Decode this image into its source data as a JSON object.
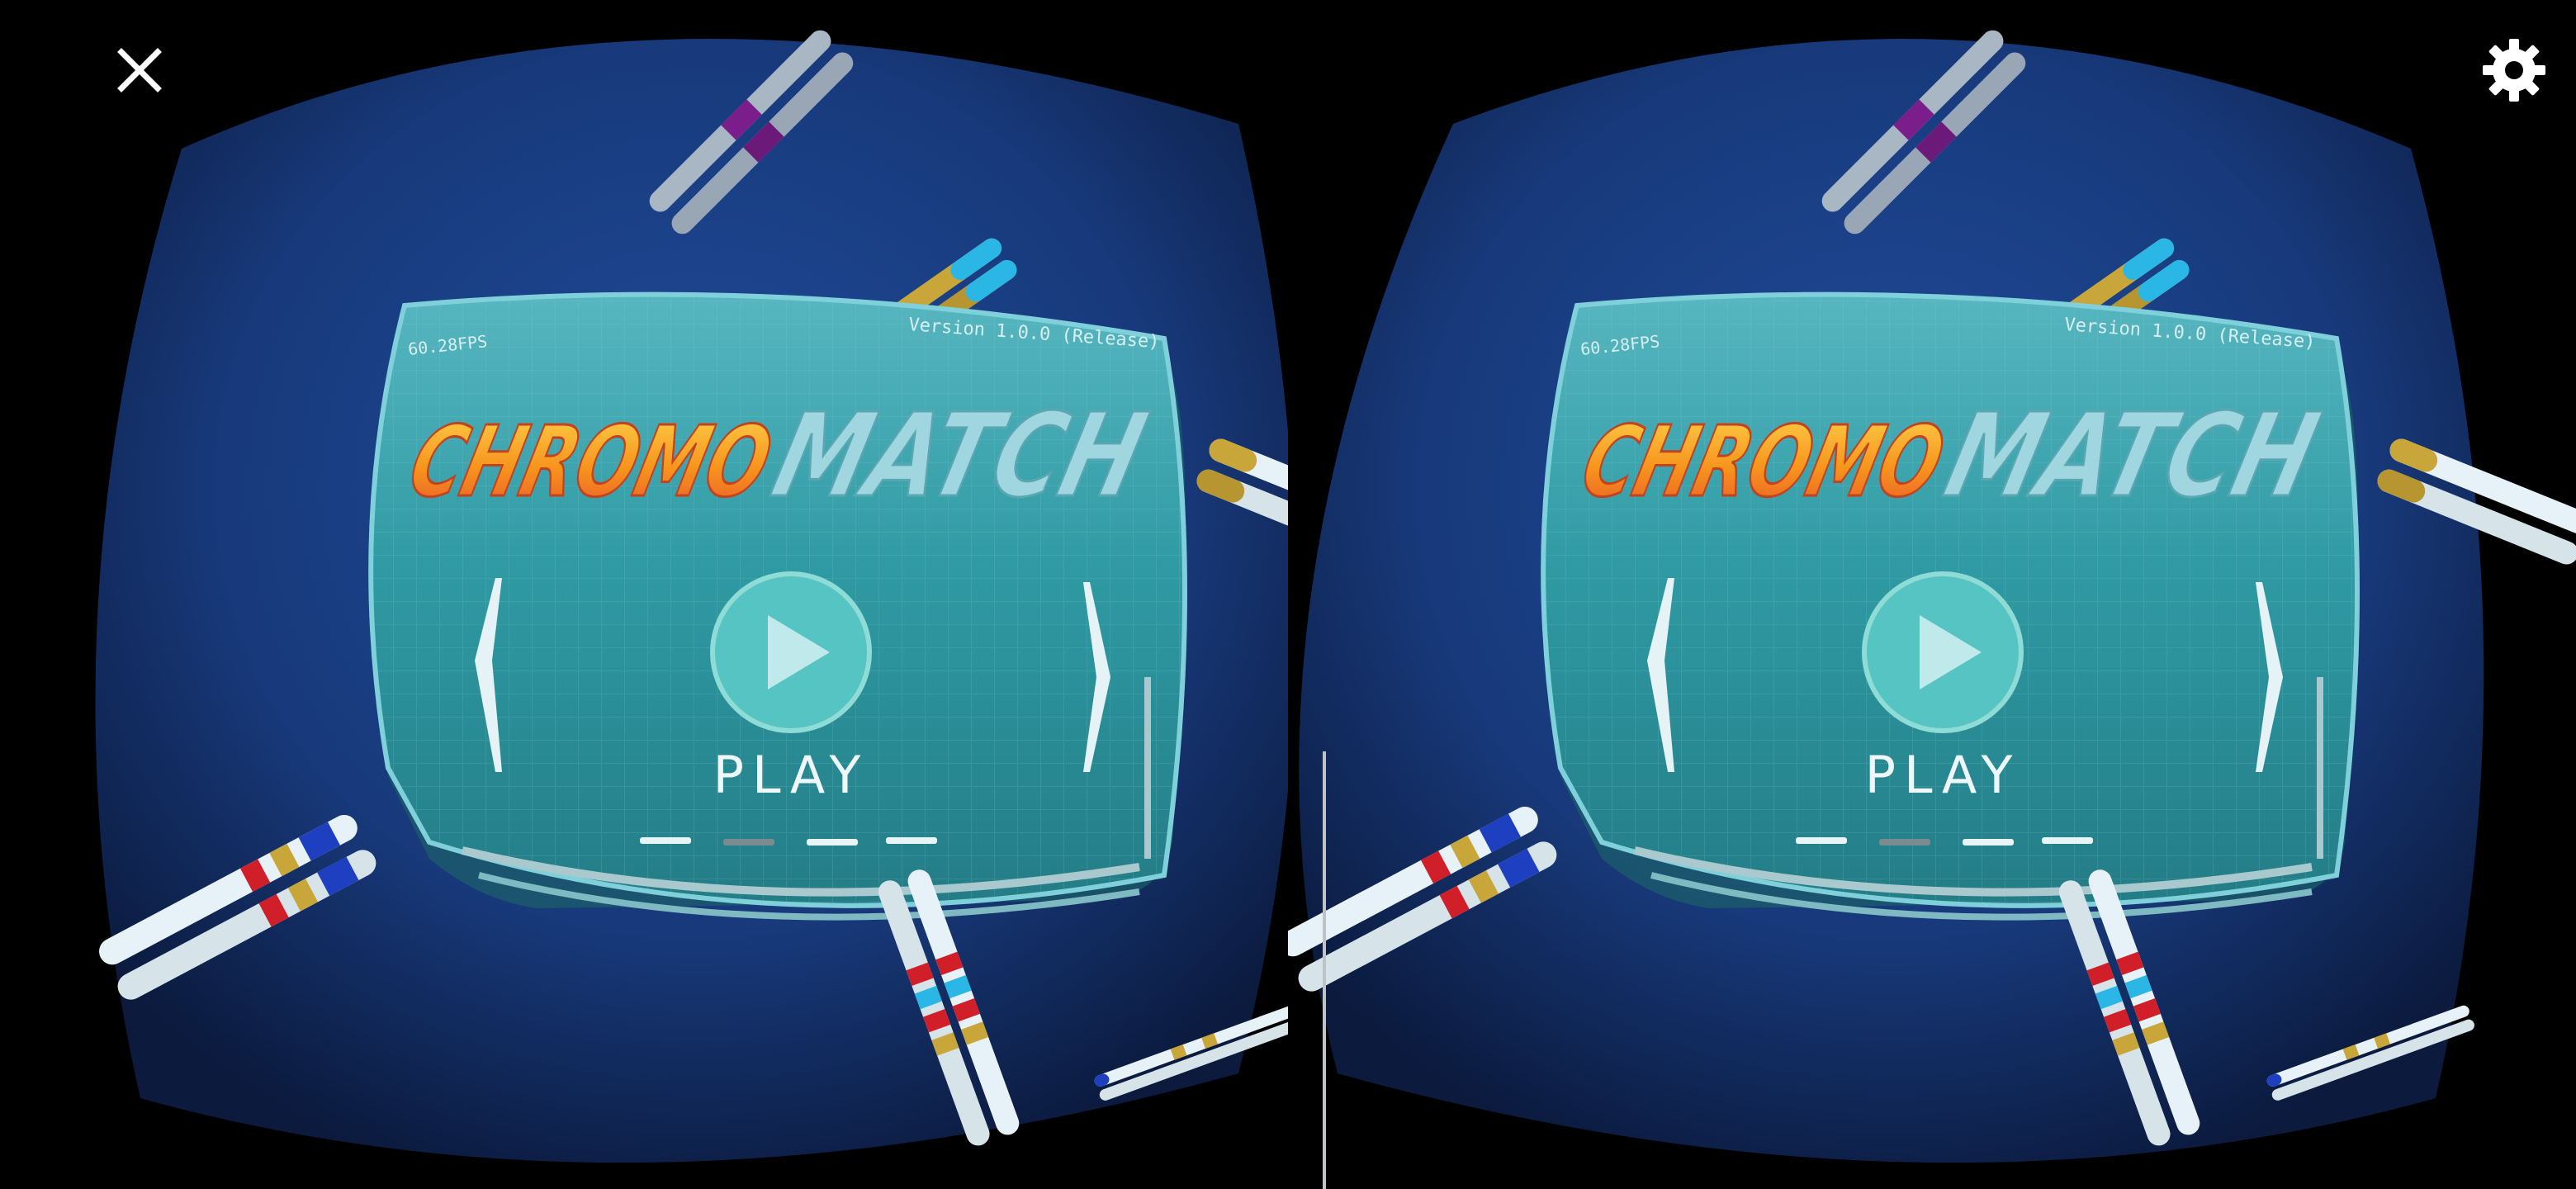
{
  "controls": {
    "close_icon": "close-icon",
    "settings_icon": "gear-icon"
  },
  "menu": {
    "fps": "60.28FPS",
    "version": "Version 1.0.0 (Release)",
    "title_part1": "CHROMO",
    "title_part2": "MATCH",
    "play_label": "PLAY",
    "page_indicator": {
      "count": 4,
      "active": 2
    }
  },
  "colors": {
    "background": "#000000",
    "vr_sky": "#1a3d86",
    "panel": "#2f9aa3",
    "title_orange": "#f7a21b",
    "title_cyan": "#8fd4e0",
    "chromosome_white": "#e7f2f8"
  }
}
